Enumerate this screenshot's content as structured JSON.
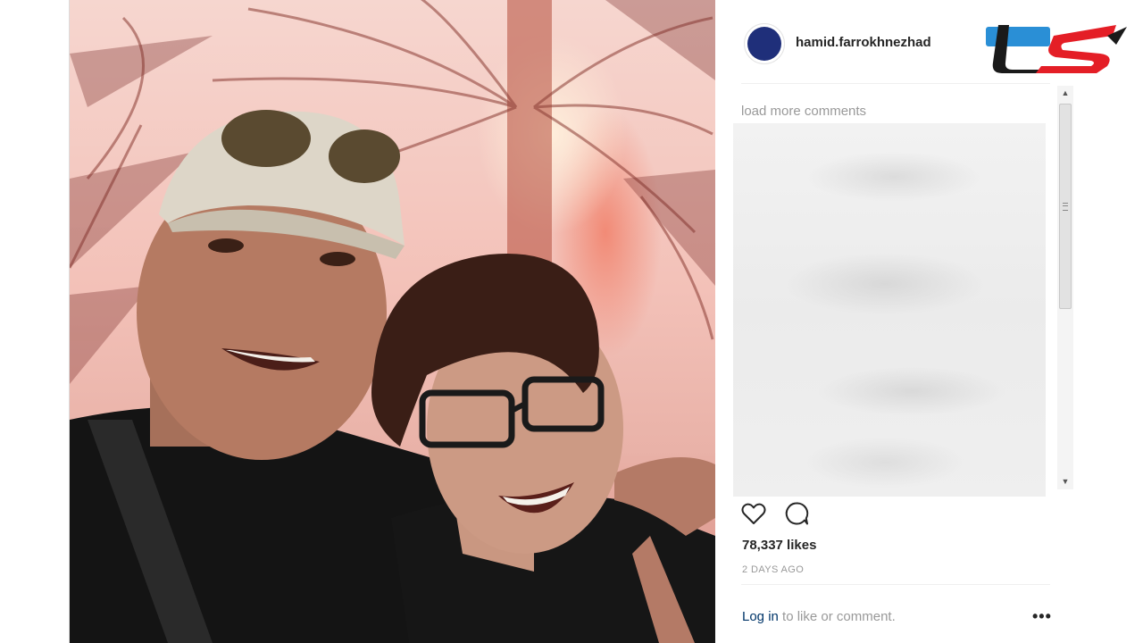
{
  "post": {
    "username": "hamid.farrokhnezhad",
    "load_more": "load more comments",
    "likes": "78,337 likes",
    "time": "2 DAYS AGO",
    "login_link": "Log in",
    "login_rest": " to like or comment.",
    "more_options": "•••"
  },
  "icons": {
    "like": "heart-icon",
    "comment": "comment-icon",
    "avatar": "profile-avatar",
    "logo": "site-logo"
  },
  "colors": {
    "logo_red": "#e41e26",
    "logo_black": "#1a1a1a",
    "logo_blue": "#2a8fd6",
    "link": "#003569"
  }
}
